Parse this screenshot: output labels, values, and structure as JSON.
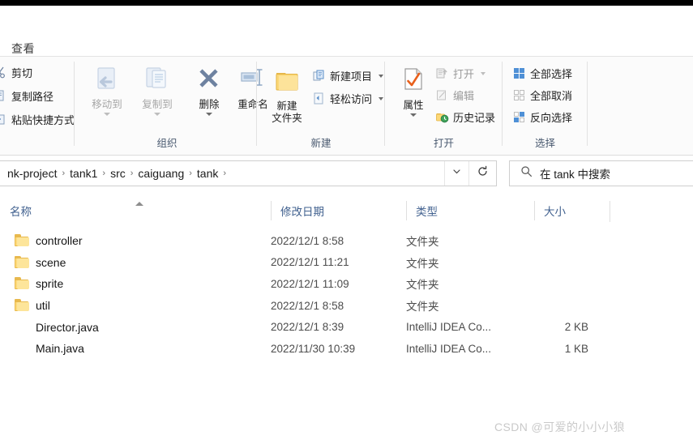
{
  "window": {
    "active_tab": "查看"
  },
  "ribbon": {
    "groups": [
      {
        "name": "clipboard",
        "label": "",
        "small_commands": [
          {
            "label": "剪切",
            "icon": "scissors-icon",
            "disabled": false
          },
          {
            "label": "复制路径",
            "icon": "copy-path-icon",
            "disabled": false
          },
          {
            "label": "粘贴快捷方式",
            "icon": "paste-shortcut-icon",
            "disabled": false
          }
        ]
      },
      {
        "name": "organize",
        "label": "组织",
        "big_commands": [
          {
            "label_line1": "移动到",
            "label_line2": "",
            "icon": "move-to-icon",
            "disabled": true,
            "has_caret": true
          },
          {
            "label_line1": "复制到",
            "label_line2": "",
            "icon": "copy-to-icon",
            "disabled": true,
            "has_caret": true
          },
          {
            "label_line1": "删除",
            "label_line2": "",
            "icon": "delete-icon",
            "disabled": false,
            "has_caret": true
          },
          {
            "label_line1": "重命名",
            "label_line2": "",
            "icon": "rename-icon",
            "disabled": false,
            "has_caret": false
          }
        ]
      },
      {
        "name": "new",
        "label": "新建",
        "big_commands": [
          {
            "label_line1": "新建",
            "label_line2": "文件夹",
            "icon": "new-folder-icon",
            "disabled": false,
            "has_caret": false
          }
        ],
        "small_commands": [
          {
            "label": "新建项目",
            "icon": "new-item-icon",
            "disabled": false,
            "has_caret": true
          },
          {
            "label": "轻松访问",
            "icon": "easy-access-icon",
            "disabled": false,
            "has_caret": true
          }
        ]
      },
      {
        "name": "open",
        "label": "打开",
        "big_commands": [
          {
            "label_line1": "属性",
            "label_line2": "",
            "icon": "properties-icon",
            "disabled": false,
            "has_caret": true
          }
        ],
        "small_commands": [
          {
            "label": "打开",
            "icon": "open-icon",
            "disabled": true,
            "has_caret": true
          },
          {
            "label": "编辑",
            "icon": "edit-icon",
            "disabled": true,
            "has_caret": false
          },
          {
            "label": "历史记录",
            "icon": "history-icon",
            "disabled": false,
            "has_caret": false
          }
        ]
      },
      {
        "name": "select",
        "label": "选择",
        "small_commands": [
          {
            "label": "全部选择",
            "icon": "select-all-icon",
            "disabled": false
          },
          {
            "label": "全部取消",
            "icon": "select-none-icon",
            "disabled": false
          },
          {
            "label": "反向选择",
            "icon": "invert-selection-icon",
            "disabled": false
          }
        ]
      }
    ]
  },
  "address_bar": {
    "breadcrumbs": [
      "nk-project",
      "tank1",
      "src",
      "caiguang",
      "tank"
    ],
    "separator": "›",
    "trailing_separator": "›",
    "dropdown_icon": "chevron-down-icon",
    "refresh_icon": "refresh-icon"
  },
  "search": {
    "icon": "search-icon",
    "placeholder": "在 tank 中搜索"
  },
  "file_list": {
    "columns": [
      {
        "key": "name",
        "label": "名称",
        "sorted": "asc"
      },
      {
        "key": "date",
        "label": "修改日期"
      },
      {
        "key": "type",
        "label": "类型"
      },
      {
        "key": "size",
        "label": "大小"
      }
    ],
    "rows": [
      {
        "name": "controller",
        "icon": "folder-icon",
        "date": "2022/12/1 8:58",
        "type": "文件夹",
        "size": ""
      },
      {
        "name": "scene",
        "icon": "folder-icon",
        "date": "2022/12/1 11:21",
        "type": "文件夹",
        "size": ""
      },
      {
        "name": "sprite",
        "icon": "folder-icon",
        "date": "2022/12/1 11:09",
        "type": "文件夹",
        "size": ""
      },
      {
        "name": "util",
        "icon": "folder-icon",
        "date": "2022/12/1 8:58",
        "type": "文件夹",
        "size": ""
      },
      {
        "name": "Director.java",
        "icon": "intellij-icon",
        "date": "2022/12/1 8:39",
        "type": "IntelliJ IDEA Co...",
        "size": "2 KB"
      },
      {
        "name": "Main.java",
        "icon": "intellij-icon",
        "date": "2022/11/30 10:39",
        "type": "IntelliJ IDEA Co...",
        "size": "1 KB"
      }
    ]
  },
  "watermark": {
    "text": "CSDN @可爱的小小小狼"
  },
  "colors": {
    "ribbon_bg": "#fbfbfb",
    "header_text": "#41618f",
    "folder": "#fcd878",
    "accent_blue": "#2e6fb7"
  }
}
